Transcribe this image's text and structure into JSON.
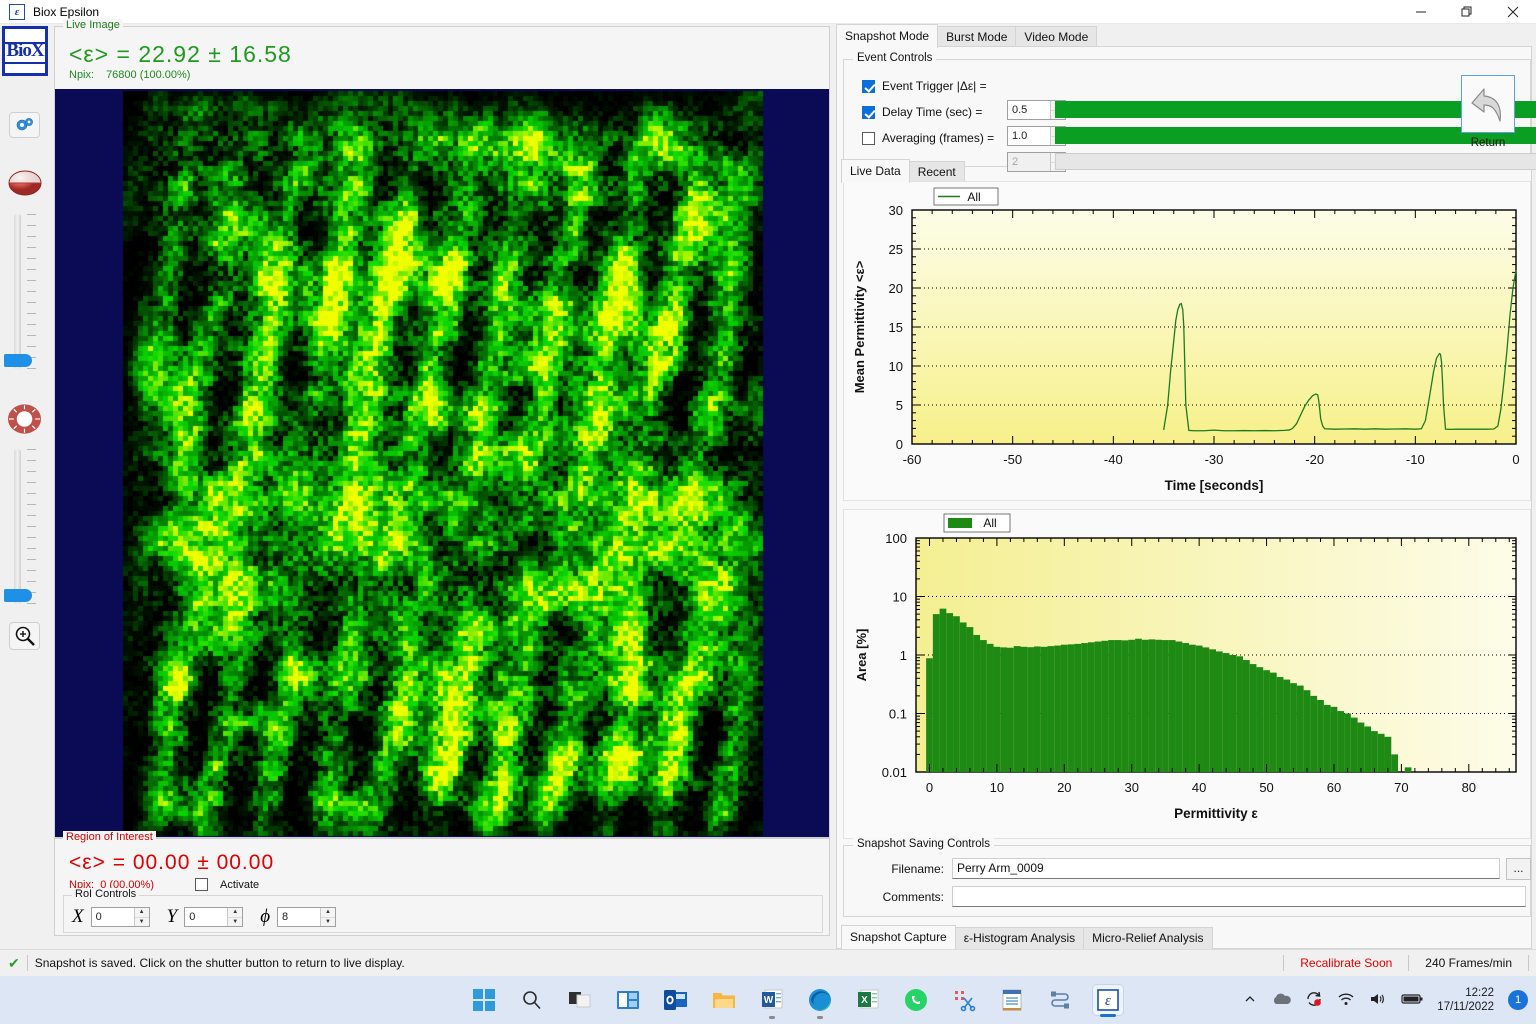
{
  "window": {
    "title": "Biox Epsilon",
    "icon": "epsilon-icon",
    "minimize": "—",
    "restore": "❐",
    "close": "✕"
  },
  "left_toolbar": {
    "logo_text": "BioX",
    "items": [
      {
        "name": "settings-gear-icon",
        "label": ""
      },
      {
        "name": "contrast-sphere-icon",
        "label": ""
      },
      {
        "name": "brightness-slider",
        "label": ""
      },
      {
        "name": "illumination-icon",
        "label": ""
      },
      {
        "name": "gain-slider",
        "label": ""
      },
      {
        "name": "zoom-in-icon",
        "label": ""
      }
    ]
  },
  "live_image": {
    "group_label": "Live Image",
    "mean_line": "<ε> =  22.92  ±  16.58",
    "npix_label": "Npix:",
    "npix_value": "76800 (100.00%)"
  },
  "roi": {
    "group_label": "Region of Interest",
    "mean_line": "<ε> = 00.00  ±  00.00",
    "npix_label": "Npix:",
    "npix_value": "0 (00.00%)",
    "activate_label": "Activate",
    "activate_checked": false,
    "controls_label": "RoI Controls",
    "x_symbol": "X",
    "x_value": "0",
    "y_symbol": "Y",
    "y_value": "0",
    "phi_symbol": "ϕ",
    "phi_value": "8"
  },
  "statusbar": {
    "message": "Snapshot is saved. Click on the shutter button to return to live display.",
    "warning": "Recalibrate Soon",
    "framerate": "240 Frames/min"
  },
  "right_panel": {
    "mode_tabs": [
      {
        "label": "Snapshot Mode",
        "active": true
      },
      {
        "label": "Burst Mode",
        "active": false
      },
      {
        "label": "Video Mode",
        "active": false
      }
    ],
    "event_controls": {
      "legend": "Event Controls",
      "rows": [
        {
          "label": "Event Trigger |Δε| =",
          "checked": true,
          "value": "0.5",
          "enabled": true
        },
        {
          "label": "Delay Time (sec) =",
          "checked": true,
          "value": "1.0",
          "enabled": true
        },
        {
          "label": "Averaging (frames) =",
          "checked": false,
          "value": "2",
          "enabled": false
        }
      ],
      "return_button_label": "Return",
      "return_icon": "undo-arrow-icon"
    },
    "data_tabs": [
      {
        "label": "Live Data",
        "active": true
      },
      {
        "label": "Recent",
        "active": false
      }
    ],
    "saving_controls": {
      "legend": "Snapshot Saving Controls",
      "filename_label": "Filename:",
      "filename_value": "Perry Arm_0009",
      "comments_label": "Comments:",
      "comments_value": "",
      "browse_label": "..."
    },
    "analysis_tabs": [
      {
        "label": "Snapshot Capture",
        "active": true
      },
      {
        "label": "ε-Histogram Analysis",
        "active": false
      },
      {
        "label": "Micro-Relief Analysis",
        "active": false
      }
    ]
  },
  "colors": {
    "accent_green": "#0a9e22",
    "line_green": "#1f7a1f",
    "hist_green": "#1e8a14",
    "plot_bg_top": "#fdfde8",
    "plot_bg_bottom": "#f7f08a",
    "warning_red": "#e00000",
    "roi_red": "#d00000",
    "taskbar_blue": "#dce6f5"
  },
  "chart_data": [
    {
      "id": "time-series",
      "type": "line",
      "title": "",
      "xlabel": "Time [seconds]",
      "ylabel": "Mean Permittivity <ε>",
      "legend": [
        "All"
      ],
      "legend_position": "top-left",
      "grid": true,
      "xlim": [
        -60,
        0
      ],
      "ylim": [
        0,
        30
      ],
      "xticks": [
        -60,
        -50,
        -40,
        -30,
        -20,
        -10,
        0
      ],
      "yticks": [
        0,
        5,
        10,
        15,
        20,
        25,
        30
      ],
      "series": [
        {
          "name": "All",
          "color": "#1f7a1f",
          "x": [
            -35.0,
            -34.6,
            -34.3,
            -34.0,
            -33.8,
            -33.6,
            -33.4,
            -33.25,
            -33.1,
            -33.0,
            -32.9,
            -32.8,
            -32.5,
            -32.0,
            -31.0,
            -30.0,
            -29.0,
            -28.0,
            -27.0,
            -26.0,
            -25.0,
            -24.0,
            -23.0,
            -22.5,
            -22.2,
            -21.8,
            -21.4,
            -21.0,
            -20.6,
            -20.2,
            -19.9,
            -19.7,
            -19.6,
            -19.5,
            -19.4,
            -19.2,
            -19.0,
            -18.0,
            -17.0,
            -16.0,
            -15.0,
            -14.0,
            -13.0,
            -12.0,
            -11.0,
            -10.0,
            -9.4,
            -9.0,
            -8.6,
            -8.2,
            -7.9,
            -7.6,
            -7.5,
            -7.4,
            -7.3,
            -7.2,
            -7.0,
            -6.5,
            -6.0,
            -5.0,
            -4.0,
            -3.0,
            -2.2,
            -1.8,
            -1.5,
            -1.2,
            -0.9,
            -0.6,
            -0.3,
            0.0
          ],
          "y": [
            1.8,
            5.0,
            9.5,
            13.2,
            15.8,
            17.2,
            17.9,
            18.0,
            17.2,
            15.0,
            10.0,
            5.0,
            1.75,
            1.7,
            1.7,
            1.78,
            1.7,
            1.7,
            1.72,
            1.7,
            1.72,
            1.7,
            1.75,
            1.8,
            2.0,
            2.6,
            3.7,
            4.8,
            5.6,
            6.2,
            6.4,
            6.3,
            5.6,
            4.5,
            3.2,
            2.3,
            1.95,
            1.9,
            1.92,
            1.95,
            1.9,
            1.95,
            1.9,
            1.92,
            1.95,
            1.9,
            1.95,
            3.0,
            6.0,
            9.2,
            11.0,
            11.6,
            11.5,
            10.5,
            8.0,
            5.0,
            1.9,
            1.88,
            1.9,
            1.9,
            1.9,
            1.9,
            1.92,
            2.3,
            4.5,
            8.0,
            12.0,
            16.5,
            20.0,
            22.3
          ]
        }
      ]
    },
    {
      "id": "permittivity-histogram",
      "type": "area",
      "title": "",
      "xlabel": "Permittivity ε",
      "ylabel": "Area [%]",
      "legend": [
        "All"
      ],
      "legend_position": "top-left",
      "grid": true,
      "yscale": "log",
      "xlim": [
        -2,
        87
      ],
      "ylim": [
        0.01,
        100
      ],
      "xticks": [
        0,
        10,
        20,
        30,
        40,
        50,
        60,
        70,
        80
      ],
      "yticks": [
        0.01,
        0.1,
        1,
        10,
        100
      ],
      "bin_width": 1,
      "series": [
        {
          "name": "All",
          "color": "#1e8a14",
          "x": [
            0,
            1,
            2,
            3,
            4,
            5,
            6,
            7,
            8,
            9,
            10,
            11,
            12,
            13,
            14,
            15,
            16,
            17,
            18,
            19,
            20,
            21,
            22,
            23,
            24,
            25,
            26,
            27,
            28,
            29,
            30,
            31,
            32,
            33,
            34,
            35,
            36,
            37,
            38,
            39,
            40,
            41,
            42,
            43,
            44,
            45,
            46,
            47,
            48,
            49,
            50,
            51,
            52,
            53,
            54,
            55,
            56,
            57,
            58,
            59,
            60,
            61,
            62,
            63,
            64,
            65,
            66,
            67,
            68,
            69,
            70,
            71,
            72
          ],
          "y": [
            0.88,
            5.0,
            6.2,
            5.2,
            4.6,
            3.6,
            3.0,
            2.2,
            1.8,
            1.55,
            1.38,
            1.35,
            1.33,
            1.42,
            1.38,
            1.36,
            1.4,
            1.38,
            1.42,
            1.45,
            1.5,
            1.52,
            1.55,
            1.6,
            1.65,
            1.7,
            1.75,
            1.8,
            1.8,
            1.78,
            1.82,
            1.9,
            1.82,
            1.85,
            1.82,
            1.8,
            1.8,
            1.7,
            1.6,
            1.5,
            1.45,
            1.35,
            1.25,
            1.15,
            1.08,
            1.0,
            0.95,
            0.82,
            0.7,
            0.62,
            0.55,
            0.5,
            0.42,
            0.38,
            0.33,
            0.3,
            0.25,
            0.2,
            0.17,
            0.14,
            0.13,
            0.11,
            0.1,
            0.085,
            0.07,
            0.06,
            0.05,
            0.045,
            0.04,
            0.02,
            0.0,
            0.012,
            0.0
          ]
        }
      ]
    }
  ],
  "taskbar": {
    "items": [
      {
        "name": "start-button",
        "label": "Start"
      },
      {
        "name": "search-icon",
        "label": "Search"
      },
      {
        "name": "task-view-icon",
        "label": "Task View"
      },
      {
        "name": "widgets-icon",
        "label": "Widgets"
      },
      {
        "name": "outlook-icon",
        "label": "Outlook"
      },
      {
        "name": "file-explorer-icon",
        "label": "File Explorer"
      },
      {
        "name": "word-icon",
        "label": "Word"
      },
      {
        "name": "edge-icon",
        "label": "Edge"
      },
      {
        "name": "excel-icon",
        "label": "Excel"
      },
      {
        "name": "whatsapp-icon",
        "label": "WhatsApp"
      },
      {
        "name": "snipping-tool-icon",
        "label": "Snipping Tool"
      },
      {
        "name": "notepad-icon",
        "label": "Notepad"
      },
      {
        "name": "sync-icon",
        "label": "Sync"
      },
      {
        "name": "epsilon-app-icon",
        "label": "Biox Epsilon"
      }
    ],
    "tray": {
      "chevron": "show-hidden-icons",
      "cloud": "onedrive-icon",
      "update": "windows-update-icon",
      "wifi": "wifi-icon",
      "volume": "volume-icon",
      "battery": "battery-icon",
      "time": "12:22",
      "date": "17/11/2022",
      "notification_count": "1"
    }
  }
}
